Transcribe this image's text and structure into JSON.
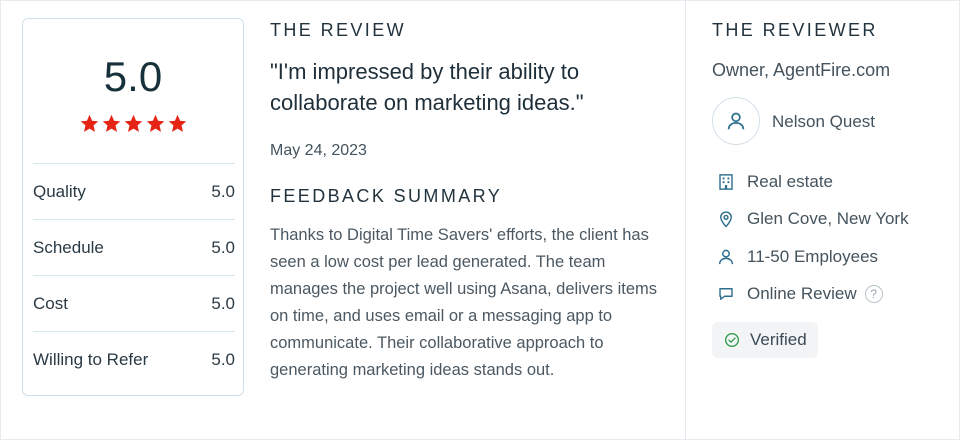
{
  "review_section": {
    "title": "THE REVIEW",
    "quote": "\"I'm impressed by their ability to collaborate on marketing ideas.\"",
    "date": "May 24, 2023",
    "summary_title": "FEEDBACK SUMMARY",
    "summary": "Thanks to Digital Time Savers' efforts, the client has seen a low cost per lead generated. The team manages the project well using Asana, delivers items on time, and uses email or a messaging app to communicate. Their collaborative approach to generating marketing ideas stands out."
  },
  "rating": {
    "overall": "5.0",
    "stars": 5,
    "star_color": "#e62415",
    "scores": [
      {
        "label": "Quality",
        "value": "5.0"
      },
      {
        "label": "Schedule",
        "value": "5.0"
      },
      {
        "label": "Cost",
        "value": "5.0"
      },
      {
        "label": "Willing to Refer",
        "value": "5.0"
      }
    ]
  },
  "reviewer": {
    "title": "THE REVIEWER",
    "role": "Owner, AgentFire.com",
    "name": "Nelson Quest",
    "industry": "Real estate",
    "location": "Glen Cove, New York",
    "employees": "11-50 Employees",
    "review_type": "Online Review",
    "help_mark": "?",
    "verified": "Verified",
    "icon_color": "#2f6f8f",
    "verified_color": "#2e9a4b"
  }
}
